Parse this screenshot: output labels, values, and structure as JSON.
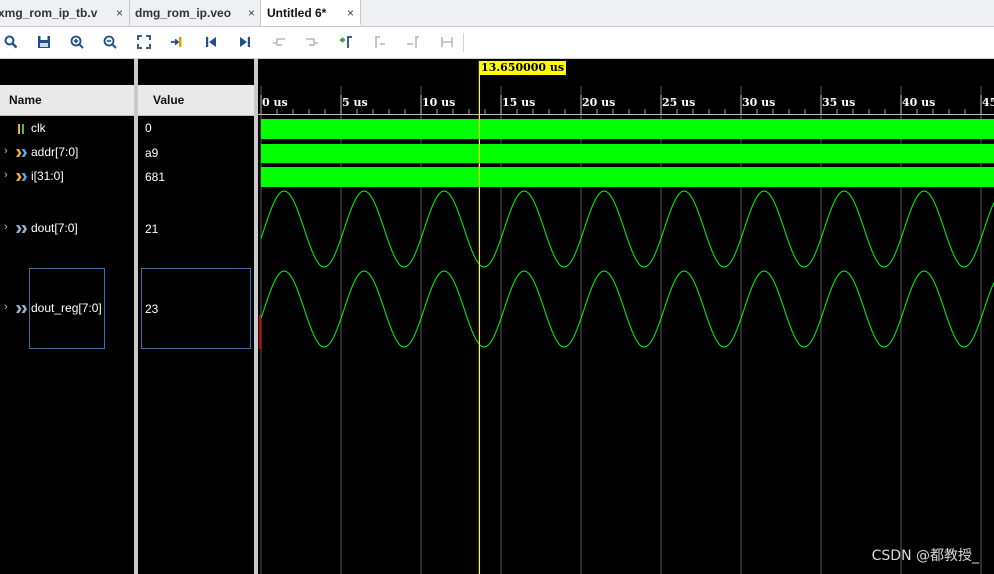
{
  "tabs": [
    {
      "label": "xmg_rom_ip_tb.v",
      "close": "×",
      "active": false
    },
    {
      "label": "dmg_rom_ip.veo",
      "close": "×",
      "active": false
    },
    {
      "label": "Untitled 6*",
      "close": "×",
      "active": true
    }
  ],
  "toolbar": [
    {
      "icon": "search-icon"
    },
    {
      "icon": "save-icon"
    },
    {
      "icon": "zoom-in-icon"
    },
    {
      "icon": "zoom-out-icon"
    },
    {
      "icon": "zoom-fit-icon"
    },
    {
      "icon": "go-to-cursor-icon"
    },
    {
      "icon": "go-to-time-zero-icon"
    },
    {
      "icon": "go-to-last-time-icon"
    },
    {
      "icon": "previous-transition-icon"
    },
    {
      "icon": "next-transition-icon"
    },
    {
      "icon": "add-marker-icon"
    },
    {
      "icon": "previous-marker-icon"
    },
    {
      "icon": "next-marker-icon"
    },
    {
      "icon": "swap-cursors-icon"
    }
  ],
  "columns": {
    "name": "Name",
    "value": "Value"
  },
  "signals": [
    {
      "name": "clk",
      "value": "0",
      "type": "bit",
      "expandable": false
    },
    {
      "name": "addr[7:0]",
      "value": "a9",
      "type": "bus",
      "expandable": true
    },
    {
      "name": "i[31:0]",
      "value": "681",
      "type": "bus",
      "expandable": true
    },
    {
      "name": "dout[7:0]",
      "value": "21",
      "type": "analog",
      "expandable": true
    },
    {
      "name": "dout_reg[7:0]",
      "value": "23",
      "type": "analog",
      "expandable": true
    }
  ],
  "timeline": {
    "unit": "us",
    "tick_labels": [
      "0 us",
      "5 us",
      "10 us",
      "15 us",
      "20 us",
      "25 us",
      "30 us",
      "35 us",
      "40 us",
      "45"
    ],
    "cursor_label": "13.650000 us",
    "cursor_time_us": 13.65,
    "sine_period_us": 5.0,
    "visible_range_us": [
      0,
      45.7
    ]
  },
  "colors": {
    "wave": "#00ff00",
    "cursor": "#ffff00",
    "grid": "#5a5a5a"
  },
  "watermark": "CSDN @都教授_"
}
